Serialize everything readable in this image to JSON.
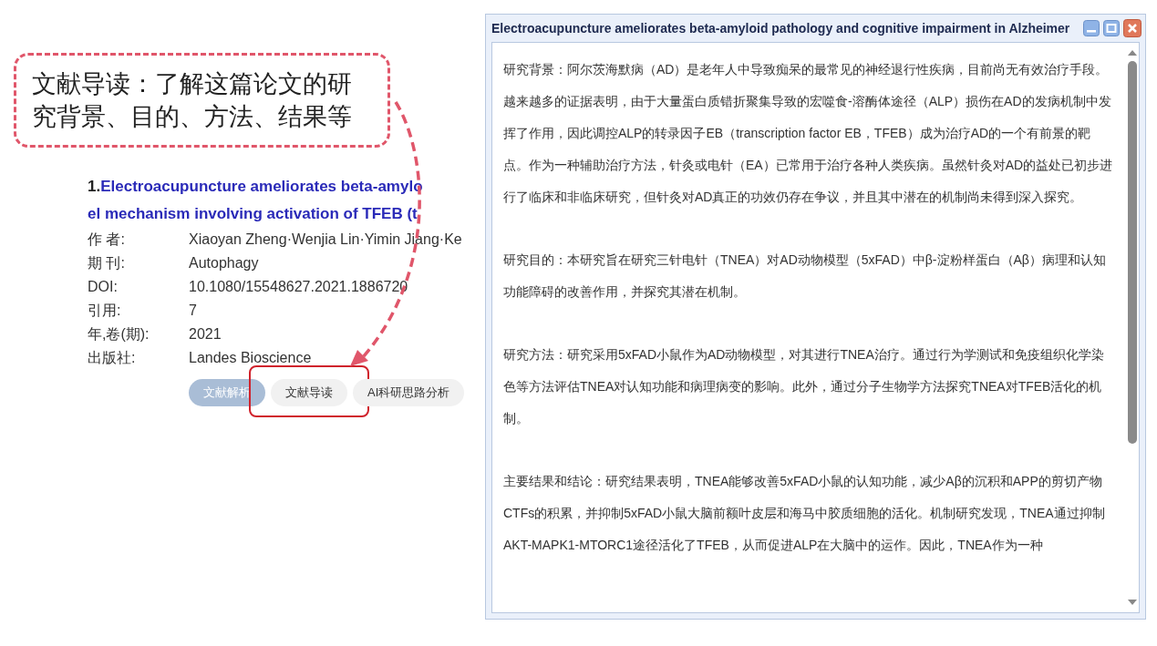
{
  "callout": {
    "text": "文献导读：了解这篇论文的研究背景、目的、方法、结果等"
  },
  "record": {
    "number": "1.",
    "title_lines": [
      "Electroacupuncture ameliorates beta-amylo",
      "el mechanism involving activation of TFEB (t"
    ],
    "fields": [
      {
        "label": "作 者:",
        "value": "Xiaoyan Zheng·Wenjia Lin·Yimin Jiang·Ke"
      },
      {
        "label": "期 刊:",
        "value": "Autophagy"
      },
      {
        "label": "DOI:",
        "value": "10.1080/15548627.2021.1886720"
      },
      {
        "label": "引用:",
        "value": "7"
      },
      {
        "label": "年,卷(期):",
        "value": "2021"
      },
      {
        "label": "出版社:",
        "value": "Landes Bioscience"
      }
    ],
    "buttons": [
      {
        "label": "文献解析",
        "selected": true,
        "highlighted": false
      },
      {
        "label": "文献导读",
        "selected": false,
        "highlighted": true
      },
      {
        "label": "AI科研思路分析",
        "selected": false,
        "highlighted": false
      }
    ]
  },
  "dialog": {
    "title": "Electroacupuncture ameliorates beta-amyloid pathology and cognitive impairment in Alzheimer",
    "paragraphs": [
      "研究背景：阿尔茨海默病（AD）是老年人中导致痴呆的最常见的神经退行性疾病，目前尚无有效治疗手段。越来越多的证据表明，由于大量蛋白质错折聚集导致的宏噬食-溶酶体途径（ALP）损伤在AD的发病机制中发挥了作用，因此调控ALP的转录因子EB（transcription factor EB，TFEB）成为治疗AD的一个有前景的靶点。作为一种辅助治疗方法，针灸或电针（EA）已常用于治疗各种人类疾病。虽然针灸对AD的益处已初步进行了临床和非临床研究，但针灸对AD真正的功效仍存在争议，并且其中潜在的机制尚未得到深入探究。",
      "研究目的：本研究旨在研究三针电针（TNEA）对AD动物模型（5xFAD）中β-淀粉样蛋白（Aβ）病理和认知功能障碍的改善作用，并探究其潜在机制。",
      "研究方法：研究采用5xFAD小鼠作为AD动物模型，对其进行TNEA治疗。通过行为学测试和免疫组织化学染色等方法评估TNEA对认知功能和病理病变的影响。此外，通过分子生物学方法探究TNEA对TFEB活化的机制。",
      "主要结果和结论：研究结果表明，TNEA能够改善5xFAD小鼠的认知功能，减少Aβ的沉积和APP的剪切产物CTFs的积累，并抑制5xFAD小鼠大脑前额叶皮层和海马中胶质细胞的活化。机制研究发现，TNEA通过抑制AKT-MAPK1-MTORC1途径活化了TFEB，从而促进ALP在大脑中的运作。因此，TNEA作为一种"
    ]
  }
}
